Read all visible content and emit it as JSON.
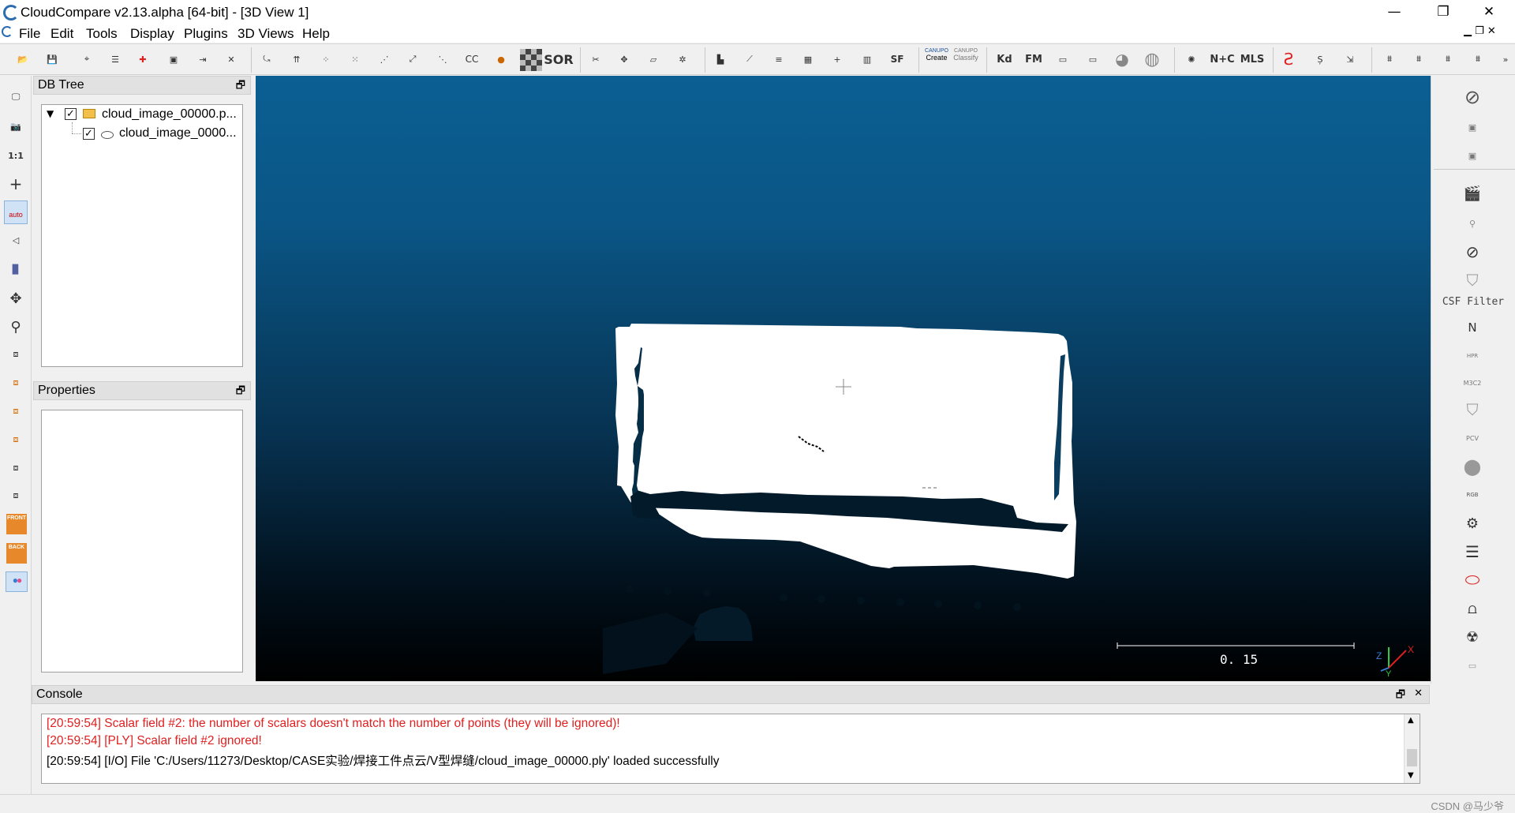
{
  "window": {
    "title": "CloudCompare v2.13.alpha [64-bit] - [3D View 1]",
    "minimize": "—",
    "restore": "❐",
    "close": "✕"
  },
  "menu": [
    "File",
    "Edit",
    "Tools",
    "Display",
    "Plugins",
    "3D Views",
    "Help"
  ],
  "toolbar": {
    "labels": [
      "CC",
      "SOR",
      "SF",
      "CANUPO",
      "Create",
      "CANUPO",
      "Classify",
      "Kd",
      "FM",
      "N+C",
      "MLS"
    ]
  },
  "left_toolbar": {
    "one_to_one": "1:1",
    "auto": "auto",
    "front": "FRONT",
    "back": "BACK"
  },
  "right_toolbar": {
    "csf_label": "CSF Filter",
    "n_label": "N",
    "hpr": "HPR",
    "m3c2": "M3C2",
    "pcv": "PCV",
    "rgb": "RGB"
  },
  "db_tree": {
    "title": "DB Tree",
    "items": [
      {
        "label": "cloud_image_00000.p...",
        "checked": true,
        "expanded": true
      },
      {
        "label": "cloud_image_0000...",
        "checked": true
      }
    ]
  },
  "properties": {
    "title": "Properties"
  },
  "viewport": {
    "scale_label": "0. 15",
    "axis_x": "X",
    "axis_y": "Y",
    "axis_z": "Z"
  },
  "console": {
    "title": "Console",
    "lines": [
      {
        "text": "[20:59:54] Scalar field #2: the number of scalars doesn't match the number of points (they will be ignored)!",
        "color": "#e02020"
      },
      {
        "text": "[20:59:54] [PLY] Scalar field #2 ignored!",
        "color": "#e02020"
      },
      {
        "text": "[20:59:54] [I/O] File 'C:/Users/11273/Desktop/CASE实验/焊接工件点云/V型焊缝/cloud_image_00000.ply' loaded successfully",
        "color": "#000000"
      }
    ]
  },
  "watermark": "CSDN @马少爷",
  "colors": {
    "accent": "#2b6cb0",
    "error": "#e02020",
    "viewport_top": "#0b5f93",
    "viewport_bottom": "#000000"
  }
}
